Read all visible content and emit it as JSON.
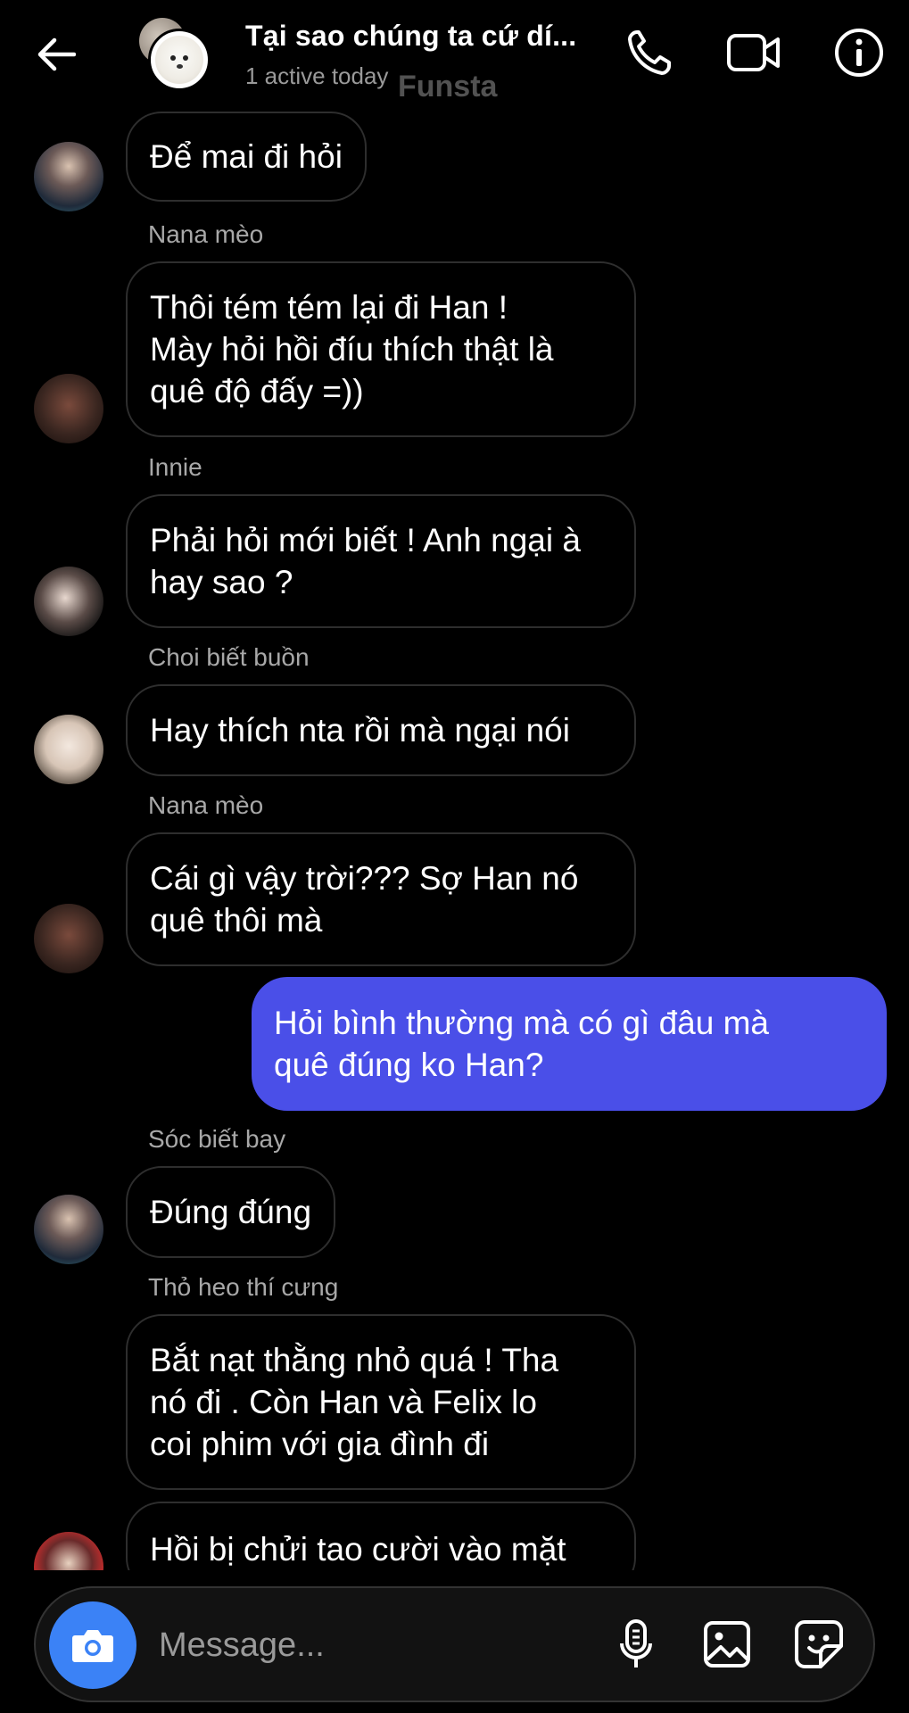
{
  "header": {
    "title": "Tại sao chúng ta cứ dí...",
    "subtitle": "1 active today",
    "watermark": "Funsta"
  },
  "messages": [
    {
      "sender": "",
      "text": "Để mai đi hỏi",
      "avatar": "avatar-boy-blue"
    },
    {
      "sender": "Nana mèo",
      "text": "Thôi tém tém lại đi Han !\nMày hỏi hồi đíu thích thật là\nquê độ đấy =))",
      "avatar": "avatar-dark"
    },
    {
      "sender": "Innie",
      "text": "Phải hỏi mới biết ! Anh ngại à\nhay sao ?",
      "avatar": "avatar-boy-red"
    },
    {
      "sender": "Choi biết buồn",
      "text": "Hay thích nta rồi mà ngại nói",
      "avatar": "avatar-glasses"
    },
    {
      "sender": "Nana mèo",
      "text": "Cái gì vậy trời??? Sợ Han nó\nquê thôi mà",
      "avatar": "avatar-dark"
    },
    {
      "sender": "",
      "text": "Hỏi bình thường mà có gì đâu mà\nquê đúng ko Han?",
      "mine": true
    },
    {
      "sender": "Sóc biết bay",
      "text": "Đúng đúng",
      "avatar": "avatar-boy-blue"
    },
    {
      "sender": "Thỏ heo thí cưng",
      "text": "Bắt nạt thằng nhỏ quá ! Tha\nnó đi . Còn Han và Felix lo\ncoi phim với gia đình đi",
      "avatar": ""
    },
    {
      "sender": "",
      "text": "Hồi bị chửi tao cười vào mặt",
      "avatar": "avatar-red"
    }
  ],
  "composer": {
    "placeholder": "Message..."
  },
  "colors": {
    "background": "#000000",
    "my_bubble": "#4a4fe8",
    "camera_button": "#3b82f6",
    "secondary_text": "#a8a8a8"
  },
  "icons": [
    "back-arrow-icon",
    "phone-icon",
    "video-camera-icon",
    "info-icon",
    "camera-icon",
    "microphone-icon",
    "gallery-icon",
    "sticker-icon"
  ]
}
